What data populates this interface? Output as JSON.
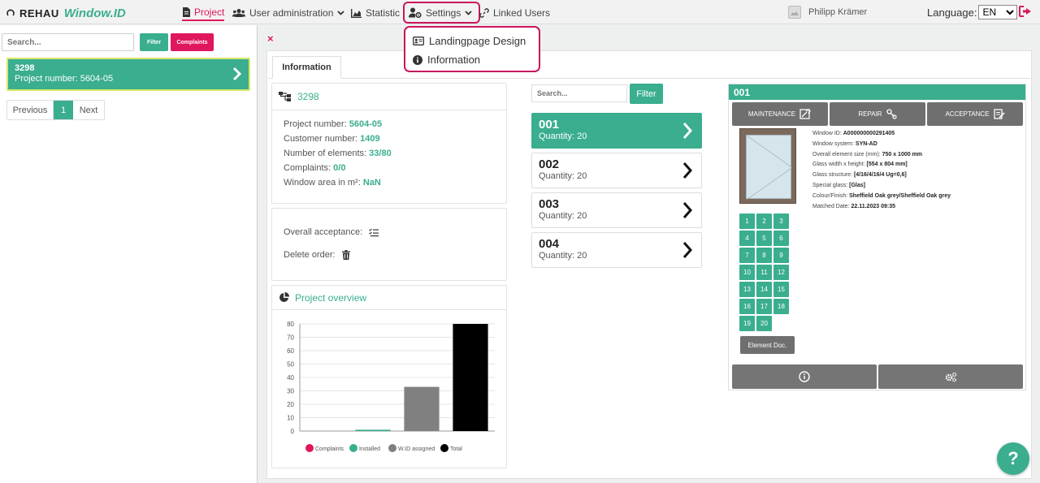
{
  "brand": {
    "company": "REHAU",
    "product": "Window.ID"
  },
  "nav": {
    "project": "Project",
    "user_admin": "User administration",
    "statistic": "Statistic",
    "settings": "Settings",
    "linked_users": "Linked Users"
  },
  "user": {
    "name": "Philipp Krämer"
  },
  "language": {
    "label": "Language:",
    "selected": "EN"
  },
  "settings_menu": {
    "items": [
      "Landingpage Design",
      "Information"
    ]
  },
  "sidebar": {
    "search_placeholder": "Search...",
    "filter_label": "Filter",
    "complaints_label": "Complaints",
    "project_card": {
      "id": "3298",
      "number_text": "Project number: 5604-05"
    },
    "pagination": {
      "prev": "Previous",
      "current": "1",
      "next": "Next"
    }
  },
  "main": {
    "close": "×",
    "tab_information": "Information",
    "project": {
      "id": "3298",
      "project_number_label": "Project number:",
      "project_number": "5604-05",
      "customer_number_label": "Customer number:",
      "customer_number": "1409",
      "elements_label": "Number of elements:",
      "elements": "33/80",
      "complaints_label": "Complaints:",
      "complaints": "0/0",
      "area_label": "Window area in m²:",
      "area": "NaN"
    },
    "actions": {
      "overall_acceptance": "Overall acceptance:",
      "delete_order": "Delete order:"
    },
    "overview_title": "Project overview"
  },
  "chart_data": {
    "type": "bar",
    "categories": [
      "Complaints",
      "Installed",
      "W.ID assigned",
      "Total"
    ],
    "values": [
      0,
      1,
      33,
      80
    ],
    "colors": [
      "#e0165e",
      "#3aae8f",
      "#808080",
      "#000000"
    ],
    "ylim": [
      0,
      80
    ],
    "yticks": [
      0,
      10,
      20,
      30,
      40,
      50,
      60,
      70,
      80
    ],
    "legend": [
      "Complaints",
      "Installed",
      "W.ID assigned",
      "Total"
    ],
    "legend_position": "bottom",
    "grid": true
  },
  "elements_list": {
    "search_placeholder": "Search...",
    "filter_label": "Filter",
    "items": [
      {
        "num": "001",
        "qty": "Quantity: 20"
      },
      {
        "num": "002",
        "qty": "Quantity: 20"
      },
      {
        "num": "003",
        "qty": "Quantity: 20"
      },
      {
        "num": "004",
        "qty": "Quantity: 20"
      }
    ]
  },
  "detail": {
    "title": "001",
    "maintenance": "MAINTENANCE",
    "repair": "REPAIR",
    "acceptance": "ACCEPTANCE",
    "props": {
      "window_id_label": "Window ID:",
      "window_id": "A000000000291405",
      "system_label": "Window system:",
      "system": "SYN-AD",
      "size_label": "Overall element size (mm):",
      "size": "750 x 1000 mm",
      "glass_label": "Glass width x height:",
      "glass": "[554 x 804 mm]",
      "structure_label": "Glass structure:",
      "structure": "[4/16/4/16/4 Ug=0,6]",
      "special_label": "Special glass:",
      "special": "[Glas]",
      "colour_label": "Colour/Finish:",
      "colour": "Sheffield Oak grey/Sheffield Oak grey",
      "matched_label": "Matched Date:",
      "matched": "22.11.2023 09:35"
    },
    "grid_numbers": [
      "1",
      "2",
      "3",
      "4",
      "5",
      "6",
      "7",
      "8",
      "9",
      "10",
      "11",
      "12",
      "13",
      "14",
      "15",
      "16",
      "17",
      "18",
      "19",
      "20"
    ],
    "element_doc": "Element Doc."
  },
  "help": "?",
  "colors": {
    "accent": "#3aae8f",
    "brand_pink": "#e0165e",
    "button_grey": "#6f6f6f"
  }
}
